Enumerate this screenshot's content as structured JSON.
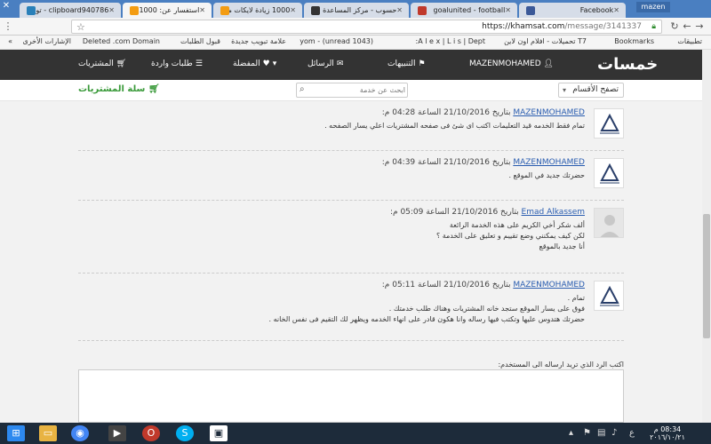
{
  "tabs": [
    {
      "title": "Facebook",
      "favicon_color": "#3b5998",
      "active": false
    },
    {
      "title": "goalunited - football",
      "favicon_color": "#c0392b",
      "active": false
    },
    {
      "title": "حسوب - مركز المساعدة",
      "favicon_color": "#333333",
      "active": false
    },
    {
      "title": "1000 زيادة لايكات منذ",
      "favicon_color": "#f39c12",
      "active": false
    },
    {
      "title": "استفسار عن: 1000 زيادة",
      "favicon_color": "#f39c12",
      "active": true
    },
    {
      "title": "clipboard940786 - تور",
      "favicon_color": "#2980b9",
      "active": false
    }
  ],
  "window_user": "mazen",
  "address": {
    "host": "https://khamsat.com",
    "path": "/message/3141337"
  },
  "bookmarks": [
    "تطبيقات",
    "Bookmarks",
    "T7 تحميلات - افلام اون لاين",
    "A l e x | L i s | Dept:",
    "(1043 unread) - yom",
    "علامة تبويب جديدة",
    "قبول الطلبات",
    "Deleted .com Domain",
    "الإشارات الأخرى"
  ],
  "site": {
    "logo": "خمسات",
    "nav": [
      "MAZENMOHAMED",
      "التنبيهات",
      "الرسائل",
      "المفضلة",
      "طلبات واردة",
      "المشتريات"
    ],
    "categories_label": "تصفح الأقسام",
    "search_placeholder": "ابحث عن خدمة",
    "cart_label": "سلة المشتريات"
  },
  "messages": [
    {
      "user": "MAZENMOHAMED",
      "meta": " بتاريخ 21/10/2016 الساعة 04:28 م:",
      "lines": [
        "تمام فقط الخدمه قيد التعليمات اكتب اى شئ فى صفحه المشتريات اعلي يسار الصفحه ."
      ],
      "avatar": "logo"
    },
    {
      "user": "MAZENMOHAMED",
      "meta": " بتاريخ 21/10/2016 الساعة 04:39 م:",
      "lines": [
        "حضرتك جديد في الموقع ."
      ],
      "avatar": "logo"
    },
    {
      "user": "Emad Alkassem",
      "meta": " بتاريخ 21/10/2016 الساعة 05:09 م:",
      "lines": [
        "ألف شكر أخي الكريم على هذه الخدمة الرائعة",
        "لكن كيف يمكنني وضع تقييم و تعليق على الخدمة ؟",
        "أنا جديد بالموقع"
      ],
      "avatar": "gray"
    },
    {
      "user": "MAZENMOHAMED",
      "meta": " بتاريخ 21/10/2016 الساعة 05:11 م:",
      "lines": [
        "تمام .",
        "فوق على يسار الموقع ستجد خانه المشتريات وهناك طلب خدمتك .",
        "حضرتك هتدوس عليها وتكتب فيها رساله وانا هكون قادر على انهاء الخدمه ويظهر لك التقيم فى نفس الخانه ."
      ],
      "avatar": "logo"
    }
  ],
  "reply_label": "اكتب الرد الذي تريد ارساله الى المستخدم:",
  "taskbar": {
    "time": "08:34 م",
    "date": "٢٠١٦/١٠/٢١",
    "lang": "ع"
  }
}
